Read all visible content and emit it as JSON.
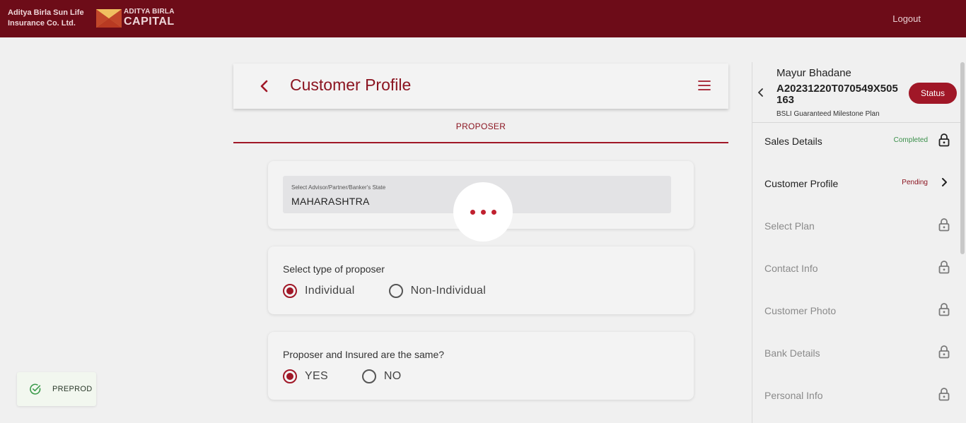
{
  "topbar": {
    "brand_line1": "Aditya Birla Sun Life",
    "brand_line2": "Insurance Co. Ltd.",
    "logo_line1": "ADITYA BIRLA",
    "logo_line2": "CAPITAL",
    "logout_label": "Logout"
  },
  "header": {
    "title": "Customer Profile",
    "back_icon": "chevron-left-icon",
    "menu_icon": "hamburger-menu-icon"
  },
  "tab": {
    "label": "PROPOSER"
  },
  "state_field": {
    "label": "Select Advisor/Partner/Banker's State",
    "value": "MAHARASHTRA"
  },
  "proposer_type": {
    "question": "Select type of proposer",
    "options": [
      {
        "label": "Individual",
        "selected": true
      },
      {
        "label": "Non-Individual",
        "selected": false
      }
    ]
  },
  "same_insured": {
    "question": "Proposer and Insured are the same?",
    "options": [
      {
        "label": "YES",
        "selected": true
      },
      {
        "label": "NO",
        "selected": false
      }
    ]
  },
  "side_panel": {
    "customer_name": "Mayur Bhadane",
    "application_no": "A20231220T070549X505163",
    "plan_name": "BSLI Guaranteed Milestone Plan",
    "status_button": "Status",
    "steps": [
      {
        "label": "Sales Details",
        "status": "Completed",
        "icon": "lock-icon",
        "state": "completed"
      },
      {
        "label": "Customer Profile",
        "status": "Pending",
        "icon": "chevron-right-icon",
        "state": "active"
      },
      {
        "label": "Select Plan",
        "status": "",
        "icon": "lock-icon",
        "state": "locked"
      },
      {
        "label": "Contact Info",
        "status": "",
        "icon": "lock-icon",
        "state": "locked"
      },
      {
        "label": "Customer Photo",
        "status": "",
        "icon": "lock-icon",
        "state": "locked"
      },
      {
        "label": "Bank Details",
        "status": "",
        "icon": "lock-icon",
        "state": "locked"
      },
      {
        "label": "Personal Info",
        "status": "",
        "icon": "lock-icon",
        "state": "locked"
      }
    ]
  },
  "env_badge": {
    "label": "PREPROD",
    "icon": "check-circle-icon"
  },
  "colors": {
    "brand_dark": "#6d0c18",
    "accent": "#a01727",
    "completed": "#3a8f4a",
    "pending": "#8b1420"
  }
}
